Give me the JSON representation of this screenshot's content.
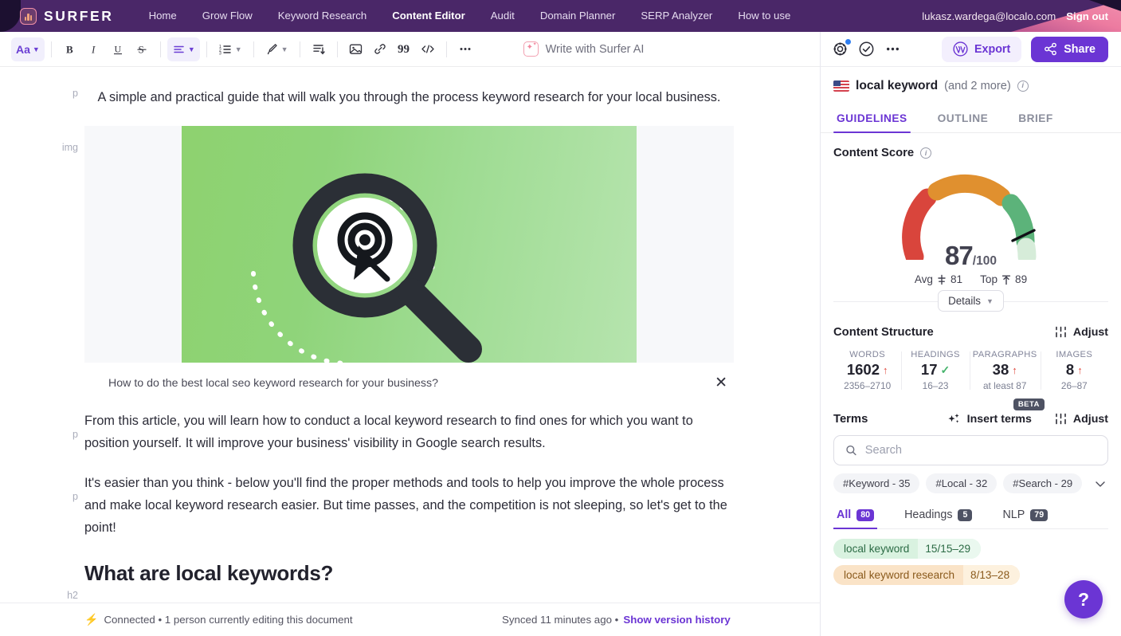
{
  "topnav": {
    "brand": "SURFER",
    "items": [
      {
        "label": "Home",
        "active": false
      },
      {
        "label": "Grow Flow",
        "active": false
      },
      {
        "label": "Keyword Research",
        "active": false
      },
      {
        "label": "Content Editor",
        "active": true
      },
      {
        "label": "Audit",
        "active": false
      },
      {
        "label": "Domain Planner",
        "active": false
      },
      {
        "label": "SERP Analyzer",
        "active": false
      },
      {
        "label": "How to use",
        "active": false
      }
    ],
    "email": "lukasz.wardega@localo.com",
    "signout": "Sign out"
  },
  "toolbar": {
    "font_label": "Aa",
    "bold": "B",
    "italic": "I",
    "underline": "U",
    "strike": "S",
    "ai_label": "Write with Surfer AI"
  },
  "document": {
    "title_fragment": "business?",
    "lead": "A simple and practical guide that will walk you through the process keyword research for your local business.",
    "image_caption": "How to do the best local seo keyword research for your business?",
    "paragraph_1": "From this article, you will learn how to conduct a local keyword research to find ones for which you want to position yourself. It will improve your business' visibility in Google search results.",
    "paragraph_2": "It's easier than you think - below you'll find the proper methods and tools to help you improve the whole process and make local keyword research easier. But time passes, and the competition is not sleeping, so let's get to the point!",
    "heading_2": "What are local keywords?",
    "gutter_p": "p",
    "gutter_img": "img",
    "gutter_h2": "h2"
  },
  "statusbar": {
    "connected": "Connected • 1 person currently editing this document",
    "synced": "Synced 11 minutes ago •",
    "version_link": "Show version history"
  },
  "panel": {
    "export_label": "Export",
    "share_label": "Share",
    "keyword": "local keyword",
    "keyword_more": "(and 2 more)",
    "tabs": [
      {
        "label": "GUIDELINES",
        "active": true
      },
      {
        "label": "OUTLINE",
        "active": false
      },
      {
        "label": "BRIEF",
        "active": false
      }
    ],
    "content_score": {
      "title": "Content Score",
      "score": "87",
      "out_of": "/100",
      "avg_label": "Avg",
      "avg_value": "81",
      "top_label": "Top",
      "top_value": "89",
      "details_label": "Details"
    },
    "content_structure": {
      "title": "Content Structure",
      "adjust_label": "Adjust",
      "stats": [
        {
          "label": "WORDS",
          "value": "1602",
          "status": "up",
          "range": "2356–2710"
        },
        {
          "label": "HEADINGS",
          "value": "17",
          "status": "check",
          "range": "16–23"
        },
        {
          "label": "PARAGRAPHS",
          "value": "38",
          "status": "up",
          "range": "at least 87"
        },
        {
          "label": "IMAGES",
          "value": "8",
          "status": "up",
          "range": "26–87"
        }
      ]
    },
    "terms": {
      "title": "Terms",
      "insert_label": "Insert terms",
      "beta_label": "BETA",
      "adjust_label": "Adjust",
      "search_placeholder": "Search",
      "search_value": "",
      "chips": [
        "#Keyword - 35",
        "#Local - 32",
        "#Search - 29"
      ],
      "subtabs": [
        {
          "label": "All",
          "count": "80",
          "active": true
        },
        {
          "label": "Headings",
          "count": "5",
          "active": false
        },
        {
          "label": "NLP",
          "count": "79",
          "active": false
        }
      ],
      "list": [
        {
          "name": "local keyword",
          "count": "15/15–29",
          "tone": "green"
        },
        {
          "name": "local keyword research",
          "count": "8/13–28",
          "tone": "amber"
        }
      ]
    },
    "help_label": "?"
  },
  "chart_data": {
    "type": "gauge",
    "title": "Content Score",
    "value": 87,
    "max": 100,
    "segments": [
      {
        "name": "low",
        "range": [
          0,
          33
        ],
        "color": "#d9453c"
      },
      {
        "name": "mid",
        "range": [
          33,
          66
        ],
        "color": "#e0902f"
      },
      {
        "name": "high",
        "range": [
          66,
          90
        ],
        "color": "#5cb37a"
      },
      {
        "name": "tail",
        "range": [
          90,
          100
        ],
        "color": "#d6ecd9"
      }
    ],
    "markers": [
      {
        "label": "Avg",
        "value": 81
      },
      {
        "label": "Top",
        "value": 89
      }
    ],
    "needle_value": 87
  }
}
